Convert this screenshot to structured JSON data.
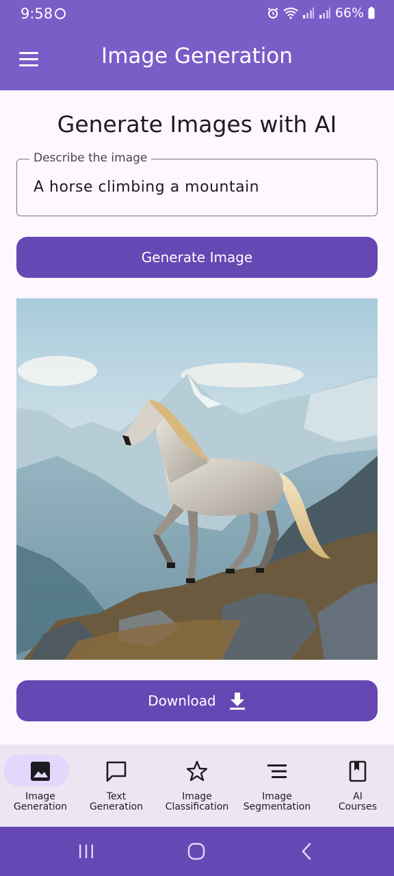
{
  "status_bar": {
    "time": "9:58",
    "battery": "66%",
    "icons": [
      "notification-icon",
      "alarm-icon",
      "wifi-icon",
      "signal-icon",
      "signal-icon",
      "battery-icon"
    ]
  },
  "app_bar": {
    "title": "Image Generation",
    "menu_icon": "hamburger-menu-icon"
  },
  "main": {
    "heading": "Generate Images with AI",
    "prompt": {
      "label": "Describe the image",
      "value": "A horse climbing a mountain"
    },
    "generate_button": "Generate Image",
    "download_button": "Download",
    "download_icon": "download-icon"
  },
  "bottom_nav": {
    "items": [
      {
        "label": "Image\nGeneration",
        "icon": "image-icon",
        "selected": true
      },
      {
        "label": "Text\nGeneration",
        "icon": "chat-bubble-icon",
        "selected": false
      },
      {
        "label": "Image\nClassification",
        "icon": "star-icon",
        "selected": false
      },
      {
        "label": "Image\nSegmentation",
        "icon": "lines-icon",
        "selected": false
      },
      {
        "label": "AI\nCourses",
        "icon": "book-icon",
        "selected": false
      }
    ]
  },
  "colors": {
    "app_bar": "#7b5dc8",
    "primary_button": "#6548b4",
    "nav_background": "#ece6f2",
    "nav_selected": "#e2d8fb"
  }
}
